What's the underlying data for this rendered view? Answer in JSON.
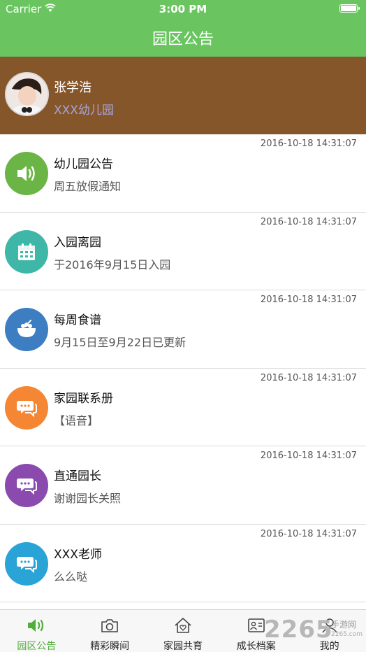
{
  "status_bar": {
    "carrier": "Carrier",
    "time": "3:00 PM"
  },
  "header": {
    "title": "园区公告"
  },
  "profile": {
    "name": "张学浩",
    "school": "XXX幼儿园"
  },
  "notices": [
    {
      "title": "幼儿园公告",
      "subtitle": "周五放假通知",
      "time": "2016-10-18 14:31:07",
      "icon": "speaker-icon",
      "color": "#6ab545"
    },
    {
      "title": "入园离园",
      "subtitle": "于2016年9月15日入园",
      "time": "2016-10-18 14:31:07",
      "icon": "calendar-icon",
      "color": "#3fb7a8"
    },
    {
      "title": "每周食谱",
      "subtitle": "9月15日至9月22日已更新",
      "time": "2016-10-18 14:31:07",
      "icon": "food-bowl-icon",
      "color": "#3c7ec1"
    },
    {
      "title": "家园联系册",
      "subtitle": "【语音】",
      "time": "2016-10-18 14:31:07",
      "icon": "chat-icon",
      "color": "#f58634"
    },
    {
      "title": "直通园长",
      "subtitle": "谢谢园长关照",
      "time": "2016-10-18 14:31:07",
      "icon": "chat-icon",
      "color": "#8a4aae"
    },
    {
      "title": "XXX老师",
      "subtitle": "么么哒",
      "time": "2016-10-18 14:31:07",
      "icon": "chat-icon",
      "color": "#2aa3d7"
    }
  ],
  "tabs": [
    {
      "label": "园区公告",
      "icon": "speaker-icon",
      "active": true
    },
    {
      "label": "精彩瞬间",
      "icon": "camera-icon",
      "active": false
    },
    {
      "label": "家园共育",
      "icon": "home-heart-icon",
      "active": false
    },
    {
      "label": "成长档案",
      "icon": "profile-card-icon",
      "active": false
    },
    {
      "label": "我的",
      "icon": "user-icon",
      "active": false
    }
  ],
  "watermark": {
    "number": "2265",
    "cn": "手游网",
    "url": "2265.com"
  },
  "colors": {
    "header_green": "#6ac561",
    "profile_brown": "#86562b",
    "active_tab": "#4fae3c"
  }
}
